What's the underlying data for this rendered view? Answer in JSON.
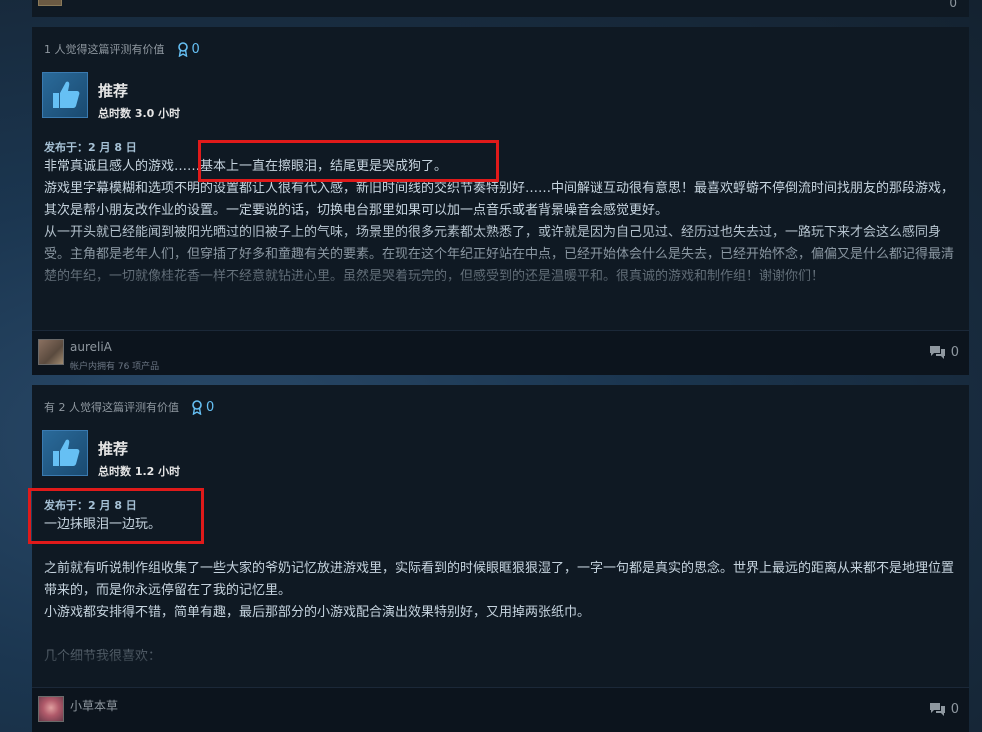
{
  "top_strip": {
    "comment_count": "0"
  },
  "reviews": [
    {
      "helpful_text": "1 人觉得这篇评测有价值",
      "award_count": "0",
      "recommendation": "推荐",
      "hours": "总时数 3.0 小时",
      "posted": "发布于：2 月 8 日",
      "paragraphs": [
        "非常真诚且感人的游戏……基本上一直在擦眼泪，结尾更是哭成狗了。",
        "游戏里字幕模糊和选项不明的设置都让人很有代入感，新旧时间线的交织节奏特别好……中间解谜互动很有意思！最喜欢蜉蝣不停倒流时间找朋友的那段游戏，其次是帮小朋友改作业的设置。一定要说的话，切换电台那里如果可以加一点音乐或者背景噪音会感觉更好。",
        "从一开头就已经能闻到被阳光晒过的旧被子上的气味，场景里的很多元素都太熟悉了，或许就是因为自己见过、经历过也失去过，一路玩下来才会这么感同身受。主角都是老年人们，但穿插了好多和童趣有关的要素。在现在这个年纪正好站在中点，已经开始体会什么是失去，已经开始怀念，偏偏又是什么都记得最清楚的年纪，一切就像桂花香一样不经意就钻进心里。虽然是哭着玩完的，但感受到的还是温暖平和。很真诚的游戏和制作组！谢谢你们！"
      ],
      "username": "aureliA",
      "products_owned": "帐户内拥有 76 项产品",
      "comment_count": "0"
    },
    {
      "helpful_text": "有 2 人觉得这篇评测有价值",
      "award_count": "0",
      "recommendation": "推荐",
      "hours": "总时数 1.2 小时",
      "posted": "发布于：2 月 8 日",
      "paragraphs": [
        "一边抹眼泪一边玩。",
        "",
        "之前就有听说制作组收集了一些大家的爷奶记忆放进游戏里，实际看到的时候眼眶狠狠湿了，一字一句都是真实的思念。世界上最远的距离从来都不是地理位置带来的，而是你永远停留在了我的记忆里。",
        "小游戏都安排得不错，简单有趣，最后那部分的小游戏配合演出效果特别好，又用掉两张纸巾。",
        "",
        "几个细节我很喜欢："
      ],
      "username": "小草本草",
      "products_owned": "",
      "comment_count": "0"
    }
  ],
  "colors": {
    "accent": "#66c0f4",
    "highlight_box": "#e01a1a",
    "card_bg": "#0f1923"
  },
  "icons": [
    "award-icon",
    "thumbs-up-icon",
    "comment-icon",
    "avatar"
  ]
}
